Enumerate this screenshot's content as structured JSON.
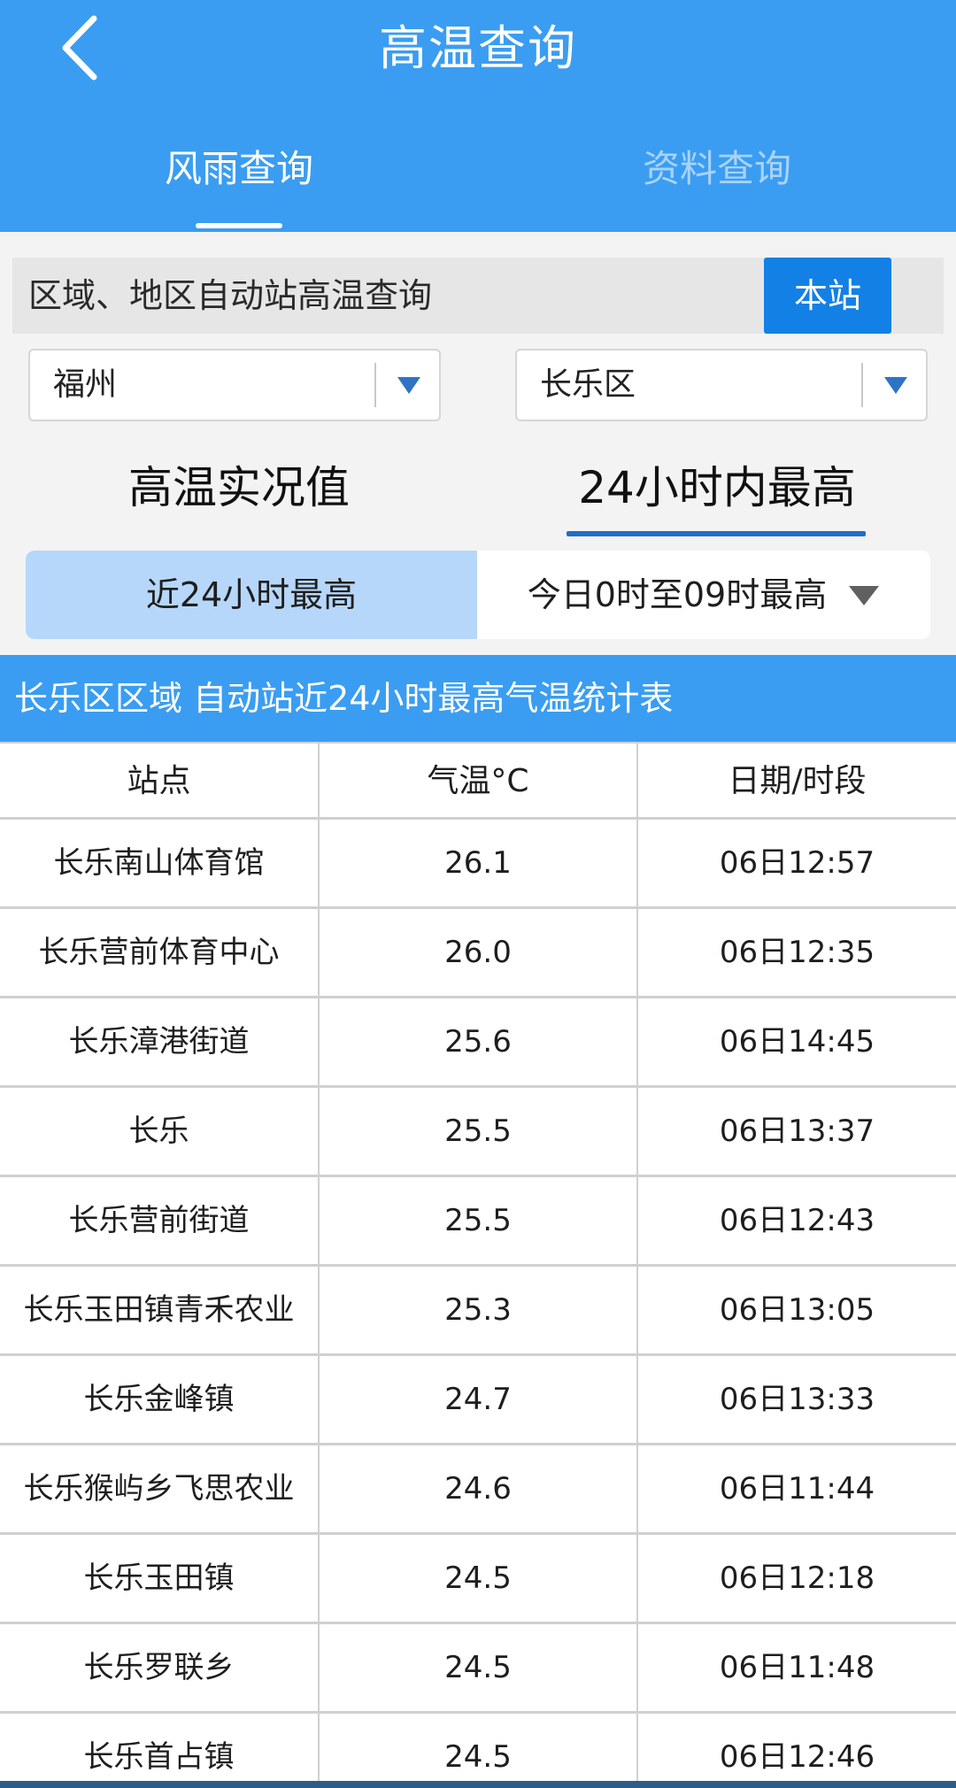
{
  "header": {
    "title": "高温查询",
    "tabs": [
      "风雨查询",
      "资料查询"
    ]
  },
  "query": {
    "label": "区域、地区自动站高温查询",
    "station_button": "本站",
    "city": "福州",
    "district": "长乐区"
  },
  "metrics": [
    "高温实况值",
    "24小时内最高"
  ],
  "segment": {
    "left": "近24小时最高",
    "right": "今日0时至09时最高"
  },
  "table": {
    "title": "长乐区区域 自动站近24小时最高气温统计表",
    "columns": [
      "站点",
      "气温°C",
      "日期/时段"
    ],
    "rows": [
      [
        "长乐南山体育馆",
        "26.1",
        "06日12:57"
      ],
      [
        "长乐营前体育中心",
        "26.0",
        "06日12:35"
      ],
      [
        "长乐漳港街道",
        "25.6",
        "06日14:45"
      ],
      [
        "长乐",
        "25.5",
        "06日13:37"
      ],
      [
        "长乐营前街道",
        "25.5",
        "06日12:43"
      ],
      [
        "长乐玉田镇青禾农业",
        "25.3",
        "06日13:05"
      ],
      [
        "长乐金峰镇",
        "24.7",
        "06日13:33"
      ],
      [
        "长乐猴屿乡飞思农业",
        "24.6",
        "06日11:44"
      ],
      [
        "长乐玉田镇",
        "24.5",
        "06日12:18"
      ],
      [
        "长乐罗联乡",
        "24.5",
        "06日11:48"
      ],
      [
        "长乐首占镇",
        "24.5",
        "06日12:46"
      ]
    ]
  },
  "colors": {
    "primary": "#3a9df2",
    "button": "#1380e6",
    "selected_segment": "#b6d7fa",
    "underline": "#1f6fc4"
  },
  "icons": {
    "back": "chevron-left-icon",
    "select": "triangle-down-icon",
    "segment": "triangle-down-icon"
  }
}
